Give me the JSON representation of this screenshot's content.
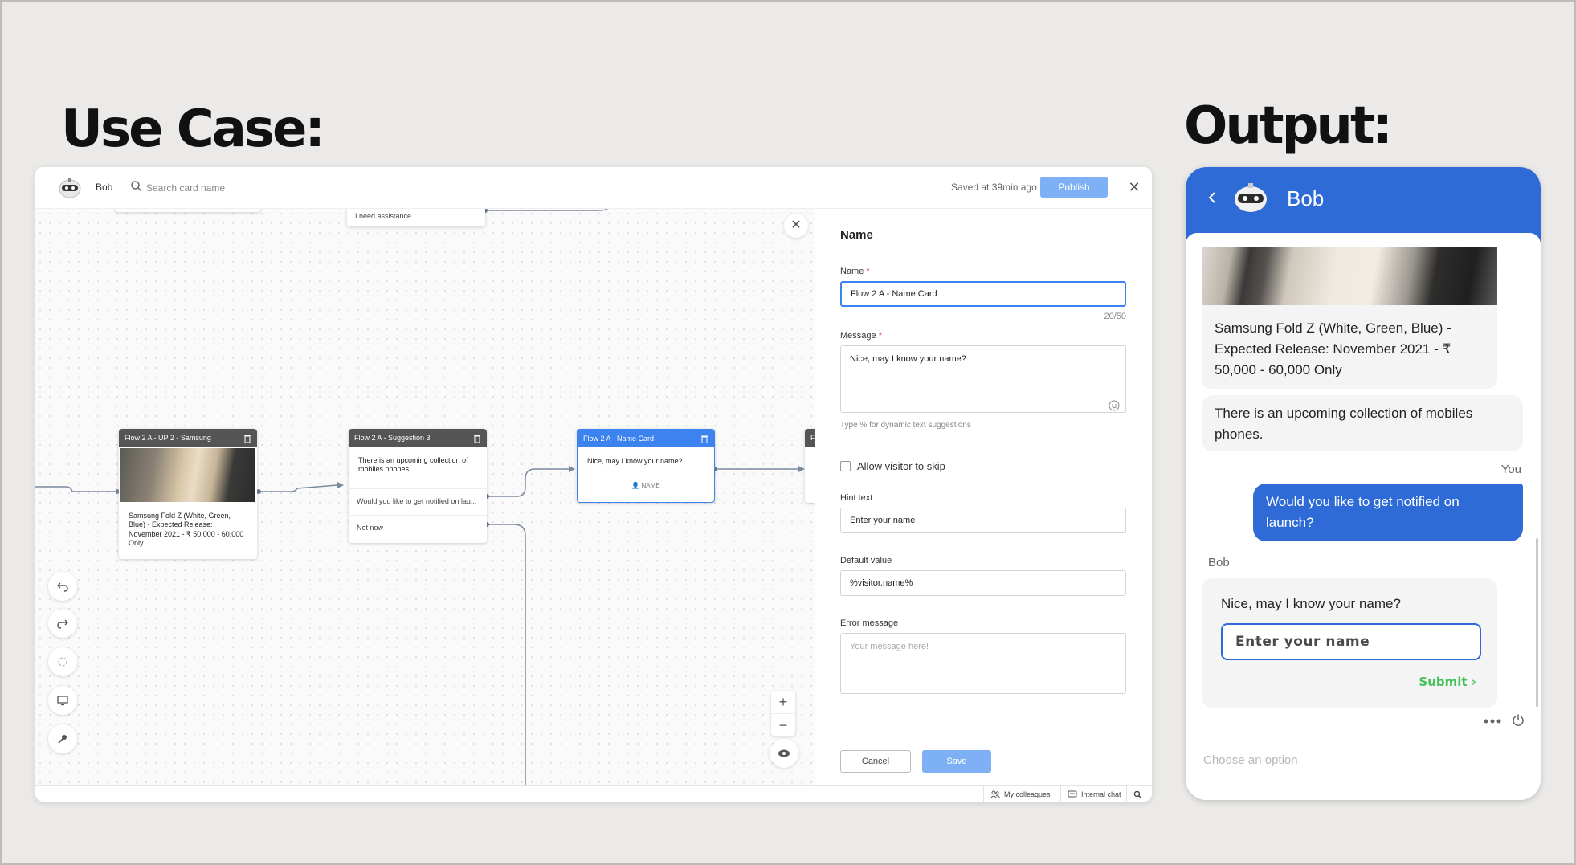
{
  "headings": {
    "left": "Use Case:",
    "right": "Output:"
  },
  "builder": {
    "bot_name": "Bob",
    "search_placeholder": "Search card name",
    "saved_text": "Saved at 39min ago",
    "publish_label": "Publish",
    "cards": {
      "top_option": "I need assistance",
      "samsung": {
        "title": "Flow 2 A - UP 2 - Samsung",
        "text": "Samsung Fold Z (White, Green, Blue) - Expected Release: November 2021 - ₹ 50,000 - 60,000 Only"
      },
      "suggestion": {
        "title": "Flow 2 A - Suggestion 3",
        "text": "There is an upcoming collection of mobiles phones.",
        "option_1": "Would you like to get notified on lau...",
        "option_2": "Not now"
      },
      "namecard": {
        "title": "Flow 2 A - Name Card",
        "text": "Nice, may I know your name?",
        "field_tag": "NAME"
      },
      "partial_title": "F"
    },
    "panel": {
      "title": "Name",
      "name_label": "Name",
      "name_value": "Flow 2 A - Name Card",
      "name_counter": "20/50",
      "message_label": "Message",
      "message_value": "Nice, may I know your name?",
      "message_hint": "Type % for dynamic text suggestions",
      "skip_label": "Allow visitor to skip",
      "hint_label": "Hint text",
      "hint_value": "Enter your name",
      "default_label": "Default value",
      "default_value": "%visitor.name%",
      "error_label": "Error message",
      "error_placeholder": "Your message here!",
      "cancel_label": "Cancel",
      "save_label": "Save"
    },
    "bottom_bar": {
      "colleagues": "My colleagues",
      "internal_chat": "Internal chat"
    }
  },
  "chat": {
    "bot_name": "Bob",
    "product_text": "Samsung Fold Z (White, Green, Blue) - Expected Release: November 2021 - ₹ 50,000 - 60,000 Only",
    "bot_message": "There is an upcoming collection of mobiles phones.",
    "you_label": "You",
    "user_message": "Would you like to get notified on launch?",
    "bob_label": "Bob",
    "question": "Nice, may I know your name?",
    "input_placeholder": "Enter your name",
    "submit_label": "Submit",
    "footer_placeholder": "Choose an option"
  },
  "colors": {
    "accent": "#3d83f0",
    "chat_header": "#2e6bd6",
    "publish": "#7eb0f5",
    "submit": "#43c05a"
  }
}
